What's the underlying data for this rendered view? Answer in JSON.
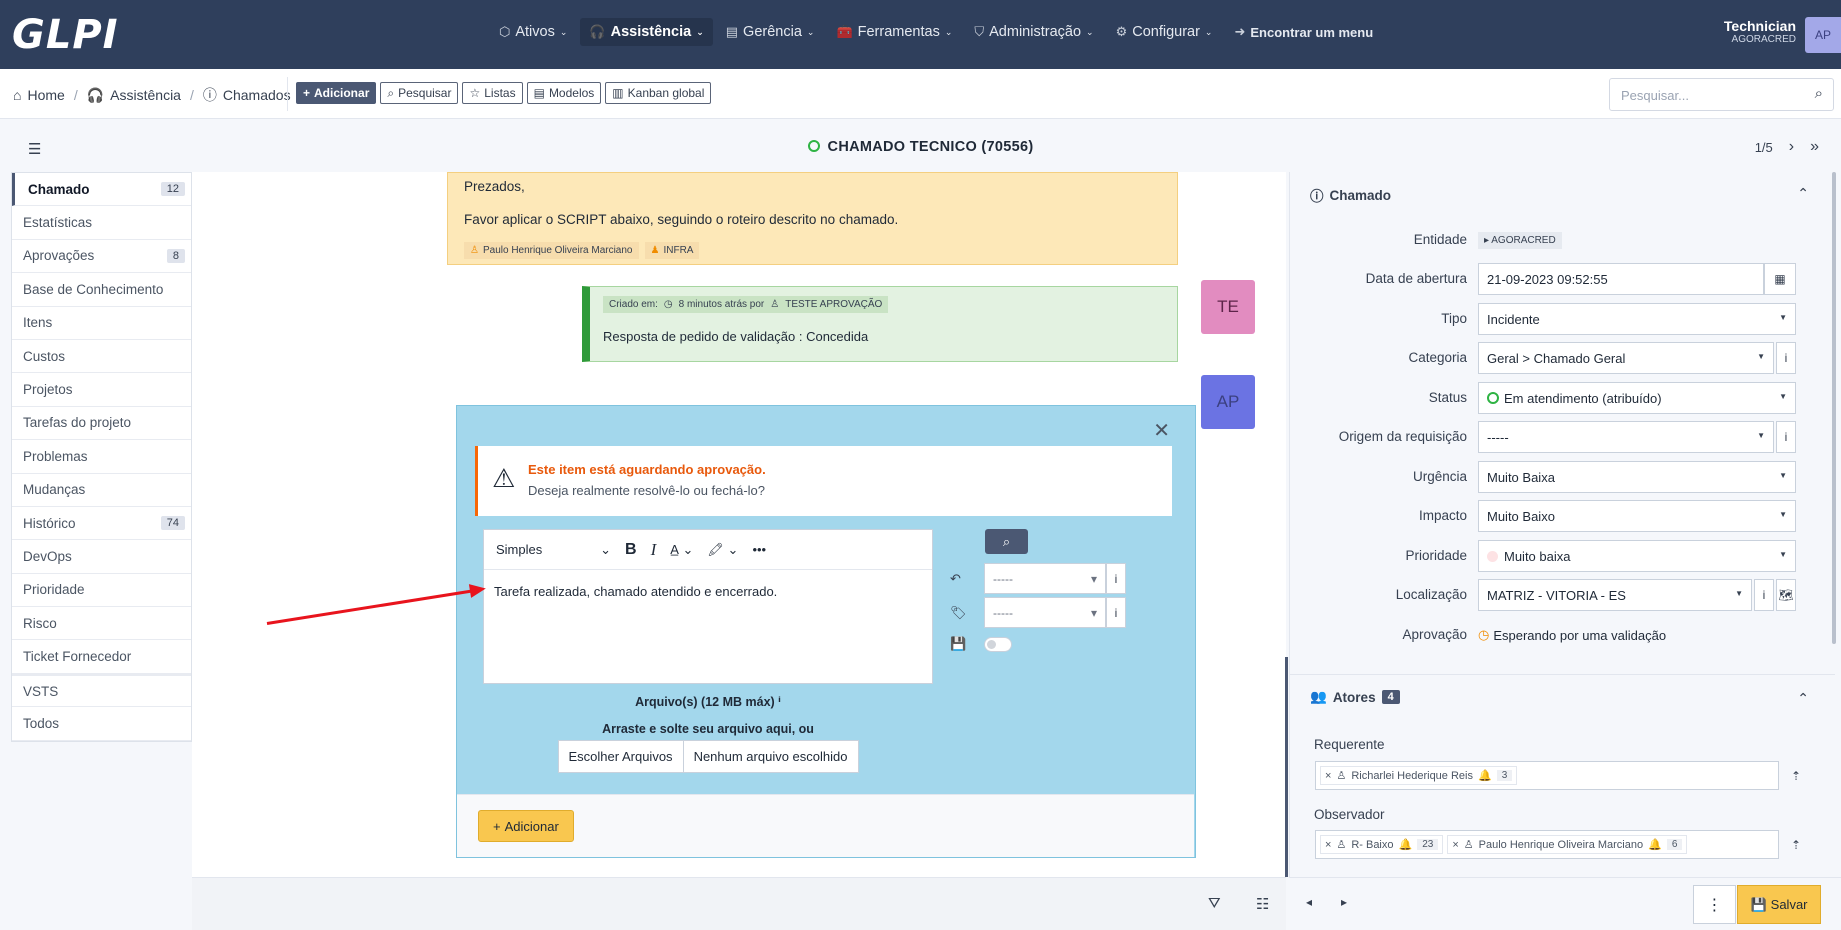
{
  "app": {
    "logo": "GLPI"
  },
  "topnav": [
    {
      "icon": "⬡",
      "label": "Ativos"
    },
    {
      "icon": "🎧",
      "label": "Assistência"
    },
    {
      "icon": "▤",
      "label": "Gerência"
    },
    {
      "icon": "🧰",
      "label": "Ferramentas"
    },
    {
      "icon": "⛉",
      "label": "Administração"
    },
    {
      "icon": "⚙",
      "label": "Configurar"
    }
  ],
  "find_menu": "Encontrar um menu",
  "user": {
    "name": "Technician",
    "entity": "AGORACRED",
    "initials": "AP"
  },
  "breadcrumb": {
    "home": "Home",
    "assist": "Assistência",
    "tickets": "Chamados"
  },
  "actions": {
    "add": "Adicionar",
    "search": "Pesquisar",
    "lists": "Listas",
    "templates": "Modelos",
    "kanban": "Kanban global"
  },
  "search": {
    "placeholder": "Pesquisar..."
  },
  "ticket": {
    "title": "CHAMADO TECNICO (70556)",
    "pager": "1/5"
  },
  "sidebar": [
    {
      "label": "Chamado",
      "badge": "12"
    },
    {
      "label": "Estatísticas",
      "badge": ""
    },
    {
      "label": "Aprovações",
      "badge": "8"
    },
    {
      "label": "Base de Conhecimento",
      "badge": ""
    },
    {
      "label": "Itens",
      "badge": ""
    },
    {
      "label": "Custos",
      "badge": ""
    },
    {
      "label": "Projetos",
      "badge": ""
    },
    {
      "label": "Tarefas do projeto",
      "badge": ""
    },
    {
      "label": "Problemas",
      "badge": ""
    },
    {
      "label": "Mudanças",
      "badge": ""
    },
    {
      "label": "Histórico",
      "badge": "74"
    },
    {
      "label": "DevOps",
      "badge": ""
    },
    {
      "label": "Prioridade",
      "badge": ""
    },
    {
      "label": "Risco",
      "badge": ""
    },
    {
      "label": "Ticket Fornecedor",
      "badge": ""
    },
    {
      "label": "VSTS",
      "badge": ""
    },
    {
      "label": "Todos",
      "badge": ""
    }
  ],
  "followup": {
    "line1": "Prezados,",
    "line2": "Favor aplicar o SCRIPT abaixo, seguindo o roteiro descrito no chamado.",
    "author": "Paulo Henrique Oliveira Marciano",
    "group": "INFRA"
  },
  "approval": {
    "created": "Criado em:",
    "when": "8 minutos atrás por",
    "by": "TESTE APROVAÇÃO",
    "message": "Resposta de pedido de validação : Concedida",
    "avatar": "TE"
  },
  "solution": {
    "avatar": "AP",
    "alert_title": "Este item está aguardando aprovação.",
    "alert_text": "Deseja realmente resolvê-lo ou fechá-lo?",
    "format": "Simples",
    "content": "Tarefa realizada, chamado atendido e encerrado.",
    "select1": "-----",
    "select2": "-----",
    "files_title": "Arquivo(s) (12 MB máx)",
    "files_drop": "Arraste e solte seu arquivo aqui, ou",
    "choose": "Escolher Arquivos",
    "no_file": "Nenhum arquivo escolhido",
    "add": "Adicionar"
  },
  "details": {
    "section": "Chamado",
    "fields": {
      "entity": {
        "label": "Entidade",
        "value": "AGORACRED"
      },
      "opening": {
        "label": "Data de abertura",
        "value": "21-09-2023 09:52:55"
      },
      "type": {
        "label": "Tipo",
        "value": "Incidente"
      },
      "category": {
        "label": "Categoria",
        "value": "Geral > Chamado Geral"
      },
      "status": {
        "label": "Status",
        "value": "Em atendimento (atribuído)"
      },
      "origin": {
        "label": "Origem da requisição",
        "value": "-----"
      },
      "urgency": {
        "label": "Urgência",
        "value": "Muito Baixa"
      },
      "impact": {
        "label": "Impacto",
        "value": "Muito Baixo"
      },
      "priority": {
        "label": "Prioridade",
        "value": "Muito baixa"
      },
      "location": {
        "label": "Localização",
        "value": "MATRIZ - VITORIA - ES"
      },
      "approval": {
        "label": "Aprovação",
        "value": "Esperando por uma validação"
      }
    }
  },
  "actors": {
    "title": "Atores",
    "count": "4",
    "requester_label": "Requerente",
    "requester": {
      "name": "Richarlei Hederique Reis",
      "count": "3"
    },
    "observer_label": "Observador",
    "observers": [
      {
        "name": "R- Baixo",
        "count": "23"
      },
      {
        "name": "Paulo Henrique Oliveira Marciano",
        "count": "6"
      }
    ]
  },
  "footer": {
    "save": "Salvar"
  },
  "colors": {
    "topbar": "#2f3f5c",
    "accent": "#4b5873",
    "warning": "#f9c74f",
    "annotation": "#e8141d"
  }
}
